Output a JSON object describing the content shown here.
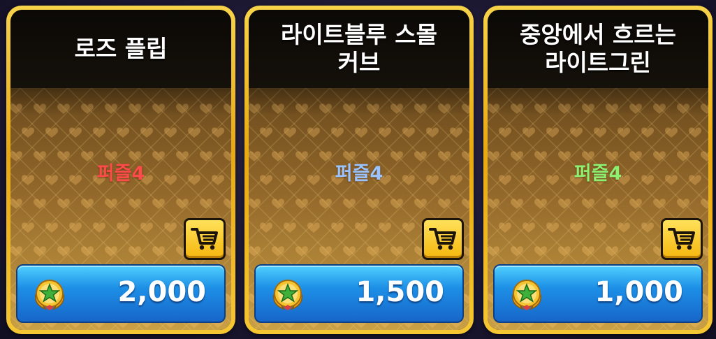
{
  "shop": {
    "items": [
      {
        "title": "로즈 플립",
        "name": "퍼즐4",
        "name_color": "#ff4a4a",
        "price": "2,000"
      },
      {
        "title": "라이트블루 스몰\n커브",
        "name": "퍼즐4",
        "name_color": "#9bc3ff",
        "price": "1,500"
      },
      {
        "title": "중앙에서 흐르는\n라이트그린",
        "name": "퍼즐4",
        "name_color": "#8ef070",
        "price": "1,000"
      }
    ],
    "icons": {
      "cart": "shopping-cart-icon",
      "currency": "star-medal-icon"
    },
    "colors": {
      "frame": "#f0b81e",
      "price_bar": "#1d8fe6",
      "cart": "#f5b70f"
    }
  }
}
